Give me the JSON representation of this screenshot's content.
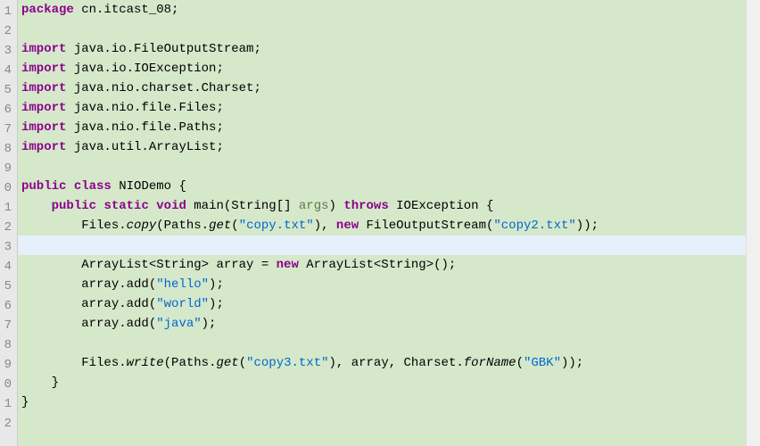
{
  "gutter": {
    "lines": [
      "1",
      "2",
      "3",
      "4",
      "5",
      "6",
      "7",
      "8",
      "9",
      "0",
      "1",
      "2",
      "3",
      "4",
      "5",
      "6",
      "7",
      "8",
      "9",
      "0",
      "1",
      "2"
    ]
  },
  "code": {
    "l1": {
      "kw": "package",
      "pkg": " cn.itcast_08;"
    },
    "l3": {
      "kw": "import",
      "pkg": " java.io.FileOutputStream;"
    },
    "l4": {
      "kw": "import",
      "pkg": " java.io.IOException;"
    },
    "l5": {
      "kw": "import",
      "pkg": " java.nio.charset.Charset;"
    },
    "l6": {
      "kw": "import",
      "pkg": " java.nio.file.Files;"
    },
    "l7": {
      "kw": "import",
      "pkg": " java.nio.file.Paths;"
    },
    "l8": {
      "kw": "import",
      "pkg": " java.util.ArrayList;"
    },
    "l10": {
      "kw1": "public",
      "kw2": "class",
      "name": " NIODemo {"
    },
    "l11": {
      "indent": "    ",
      "kw1": "public",
      "kw2": "static",
      "kw3": "void",
      "method": " main(String[] ",
      "arg": "args",
      "paren": ") ",
      "kw4": "throws",
      "exc": " IOException {"
    },
    "l12": {
      "indent": "        ",
      "call1": "Files.",
      "m1": "copy",
      "p1": "(Paths.",
      "m2": "get",
      "p2": "(",
      "s1": "\"copy.txt\"",
      "p3": "), ",
      "kw": "new",
      "ctor": " FileOutputStream(",
      "s2": "\"copy2.txt\"",
      "p4": "));"
    },
    "l14": {
      "indent": "        ",
      "type": "ArrayList<String> array = ",
      "kw": "new",
      "ctor": " ArrayList<String>();"
    },
    "l15": {
      "indent": "        ",
      "call": "array.add(",
      "s": "\"hello\"",
      "end": ");"
    },
    "l16": {
      "indent": "        ",
      "call": "array.add(",
      "s": "\"world\"",
      "end": ");"
    },
    "l17": {
      "indent": "        ",
      "call": "array.add(",
      "s": "\"java\"",
      "end": ");"
    },
    "l19": {
      "indent": "        ",
      "call1": "Files.",
      "m1": "write",
      "p1": "(Paths.",
      "m2": "get",
      "p2": "(",
      "s1": "\"copy3.txt\"",
      "p3": "), array, Charset.",
      "m3": "forName",
      "p4": "(",
      "s2": "\"GBK\"",
      "p5": "));"
    },
    "l20": {
      "indent": "    ",
      "brace": "}"
    },
    "l21": {
      "brace": "}"
    }
  }
}
